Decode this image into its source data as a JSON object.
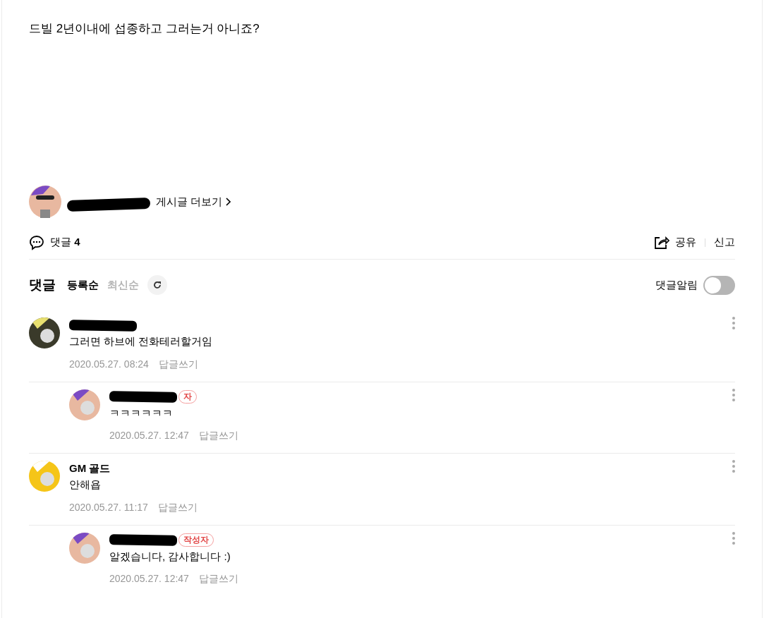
{
  "post": {
    "body": "드빌 2년이내에 섭종하고 그러는거 아니죠?"
  },
  "author_bar": {
    "redacted": true,
    "more_link": "게시글 더보기"
  },
  "actions": {
    "comment_label": "댓글",
    "comment_count": "4",
    "share": "공유",
    "report": "신고"
  },
  "comments_header": {
    "title": "댓글",
    "sort_tabs": [
      {
        "label": "등록순",
        "selected": true
      },
      {
        "label": "최신순",
        "selected": false
      }
    ],
    "alarm": {
      "label": "댓글알림",
      "on": false
    }
  },
  "comments": [
    {
      "redacted": true,
      "text": "그러면 하브에 전화테러할거임",
      "time": "2020.05.27. 08:24",
      "reply_link": "답글쓰기",
      "children": [
        {
          "redacted": true,
          "badge": "자",
          "text": "ㅋㅋㅋㅋㅋㅋ",
          "time": "2020.05.27. 12:47",
          "reply_link": "답글쓰기"
        }
      ]
    },
    {
      "author": "GM 골드",
      "text": "안해욥",
      "time": "2020.05.27. 11:17",
      "reply_link": "답글쓰기",
      "children": [
        {
          "redacted": true,
          "badge": "작성자",
          "text": "알겠습니다, 감사합니다 :)",
          "time": "2020.05.27. 12:47",
          "reply_link": "답글쓰기"
        }
      ]
    }
  ]
}
